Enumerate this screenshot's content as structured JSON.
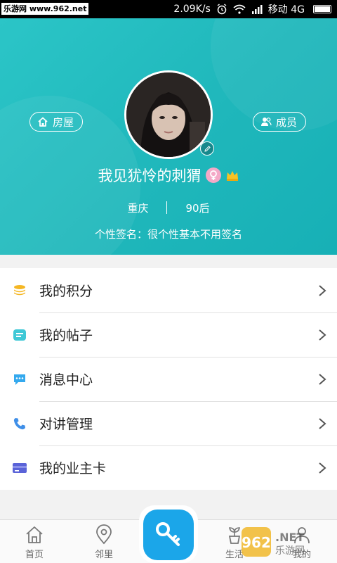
{
  "status_bar": {
    "watermark": "乐游网 www.962.net",
    "network_speed": "2.09K/s",
    "carrier": "移动 4G"
  },
  "header": {
    "house_button": "房屋",
    "members_button": "成员",
    "username": "我见犹怜的刺猬",
    "city": "重庆",
    "age_group": "90后",
    "signature": "个性签名：很个性基本不用签名"
  },
  "menu": {
    "items": [
      {
        "label": "我的积分",
        "icon": "coins-icon",
        "color": "#f5b724"
      },
      {
        "label": "我的帖子",
        "icon": "posts-icon",
        "color": "#3fc8d6"
      },
      {
        "label": "消息中心",
        "icon": "message-icon",
        "color": "#34a9ee"
      },
      {
        "label": "对讲管理",
        "icon": "phone-icon",
        "color": "#3f8fe8"
      },
      {
        "label": "我的业主卡",
        "icon": "card-icon",
        "color": "#5a63d8"
      }
    ]
  },
  "bottom_nav": {
    "home": "首页",
    "neighbor": "邻里",
    "life": "生活",
    "mine": "我的"
  },
  "colors": {
    "header_teal": "#1fb7bb",
    "key_blue": "#1ba6e9"
  }
}
